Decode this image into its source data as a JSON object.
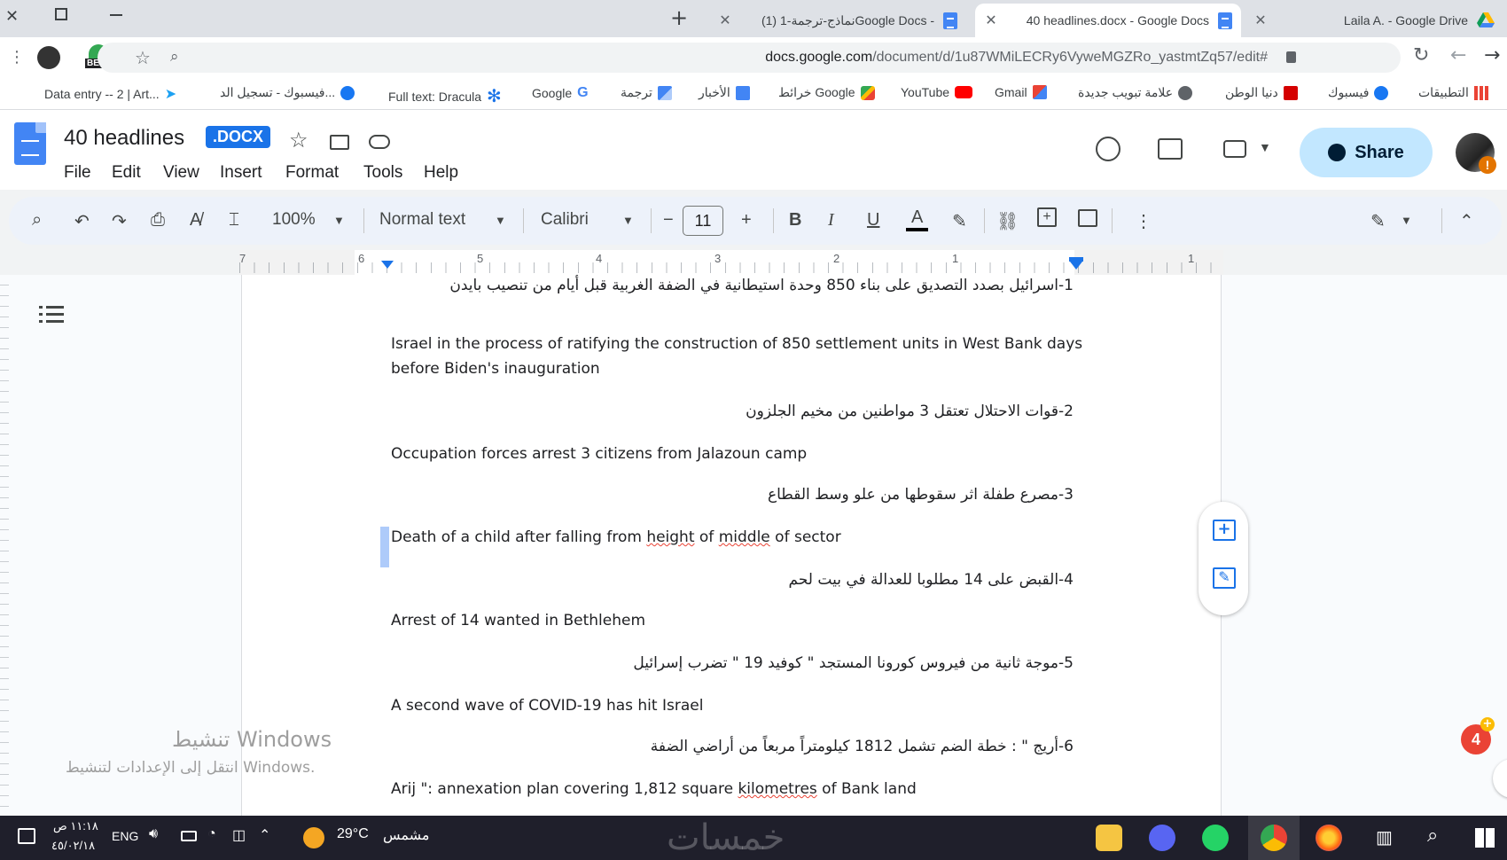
{
  "browser": {
    "tabs": [
      {
        "title": "Laila A. - Google Drive",
        "close": "✕",
        "active": false
      },
      {
        "title": "40 headlines.docx - Google Docs",
        "close": "✕",
        "active": true
      },
      {
        "title": "نماذج-ترجمة-1 (1)Google Docs -",
        "close": "✕",
        "active": false
      }
    ],
    "new_tab": "+",
    "url_host": "docs.google.com",
    "url_path": "/document/d/1u87WMiLECRy6VyweMGZRo_yastmtZq57/edit#",
    "beta_label": "BETA",
    "bookmarks": [
      "التطبيقات",
      "فيسبوك",
      "دنيا الوطن",
      "علامة تبويب جديدة",
      "Gmail",
      "YouTube",
      "خرائط Google",
      "الأخبار",
      "ترجمة",
      "Google",
      "Full text: Dracula",
      "فيسبوك - تسجيل الد...",
      "Data entry -- 2 | Art..."
    ]
  },
  "doc": {
    "title": "40 headlines",
    "badge": ".DOCX",
    "menu": [
      "File",
      "Edit",
      "View",
      "Insert",
      "Format",
      "Tools",
      "Help"
    ],
    "share_label": "Share"
  },
  "toolbar": {
    "zoom": "100%",
    "style": "Normal text",
    "font": "Calibri",
    "font_size": "11",
    "bold": "B",
    "italic": "I",
    "underline": "U",
    "text_color": "A"
  },
  "ruler": {
    "numbers": [
      "7",
      "6",
      "5",
      "4",
      "3",
      "2",
      "1",
      "1"
    ]
  },
  "content": {
    "paragraphs": [
      {
        "lang": "ar",
        "text": "1-اسرائيل بصدد التصديق على بناء 850 وحدة استيطانية في الضفة الغربية قبل أيام من تنصيب بايدن"
      },
      {
        "lang": "en",
        "text": "Israel in the process of ratifying the construction of 850 settlement units in  West Bank days"
      },
      {
        "lang": "en",
        "text": "before Biden's inauguration"
      },
      {
        "lang": "ar",
        "text": "2-قوات الاحتلال تعتقل 3 مواطنين من مخيم الجلزون"
      },
      {
        "lang": "en",
        "text": "Occupation forces arrest 3 citizens from Jalazoun camp"
      },
      {
        "lang": "ar",
        "text": "3-مصرع طفلة اثر سقوطها من علو وسط القطاع"
      },
      {
        "lang": "en",
        "parts": [
          "Death of a child after falling from  ",
          "height",
          " of  ",
          "middle",
          " of  sector"
        ]
      },
      {
        "lang": "ar",
        "text": "4-القبض على 14 مطلوبا للعدالة في بيت لحم"
      },
      {
        "lang": "en",
        "text": "Arrest of 14 wanted in Bethlehem"
      },
      {
        "lang": "ar",
        "text": "5-موجة ثانية من فيروس كورونا المستجد \" كوفيد 19 \" تضرب إسرائيل"
      },
      {
        "lang": "en",
        "text": "A second wave of COVID-19 has hit Israel"
      },
      {
        "lang": "ar",
        "text": "6-أريج \" : خطة الضم تشمل 1812 كيلومتراً مربعاً من أراضي الضفة"
      },
      {
        "lang": "en",
        "parts": [
          "Arij \": annexation plan covering 1,812 square ",
          "kilometres",
          " of Bank land"
        ]
      }
    ],
    "watermark_title": "تنشيط Windows",
    "watermark_sub": "انتقل إلى الإعدادات لتنشيط Windows.",
    "notification_count": "4"
  },
  "taskbar": {
    "time": "١١:١٨ ص",
    "date": "٤٥/٠٢/١٨",
    "lang": "ENG",
    "weather_temp": "29°C",
    "weather_text": "مشمس",
    "site_watermark": "خمسات"
  },
  "colors": {
    "accent": "#1a73e8",
    "share_bg": "#c2e7ff",
    "toolbar_bg": "#edf2fa",
    "taskbar_bg": "#1f1f2b",
    "notif": "#ea4335"
  }
}
